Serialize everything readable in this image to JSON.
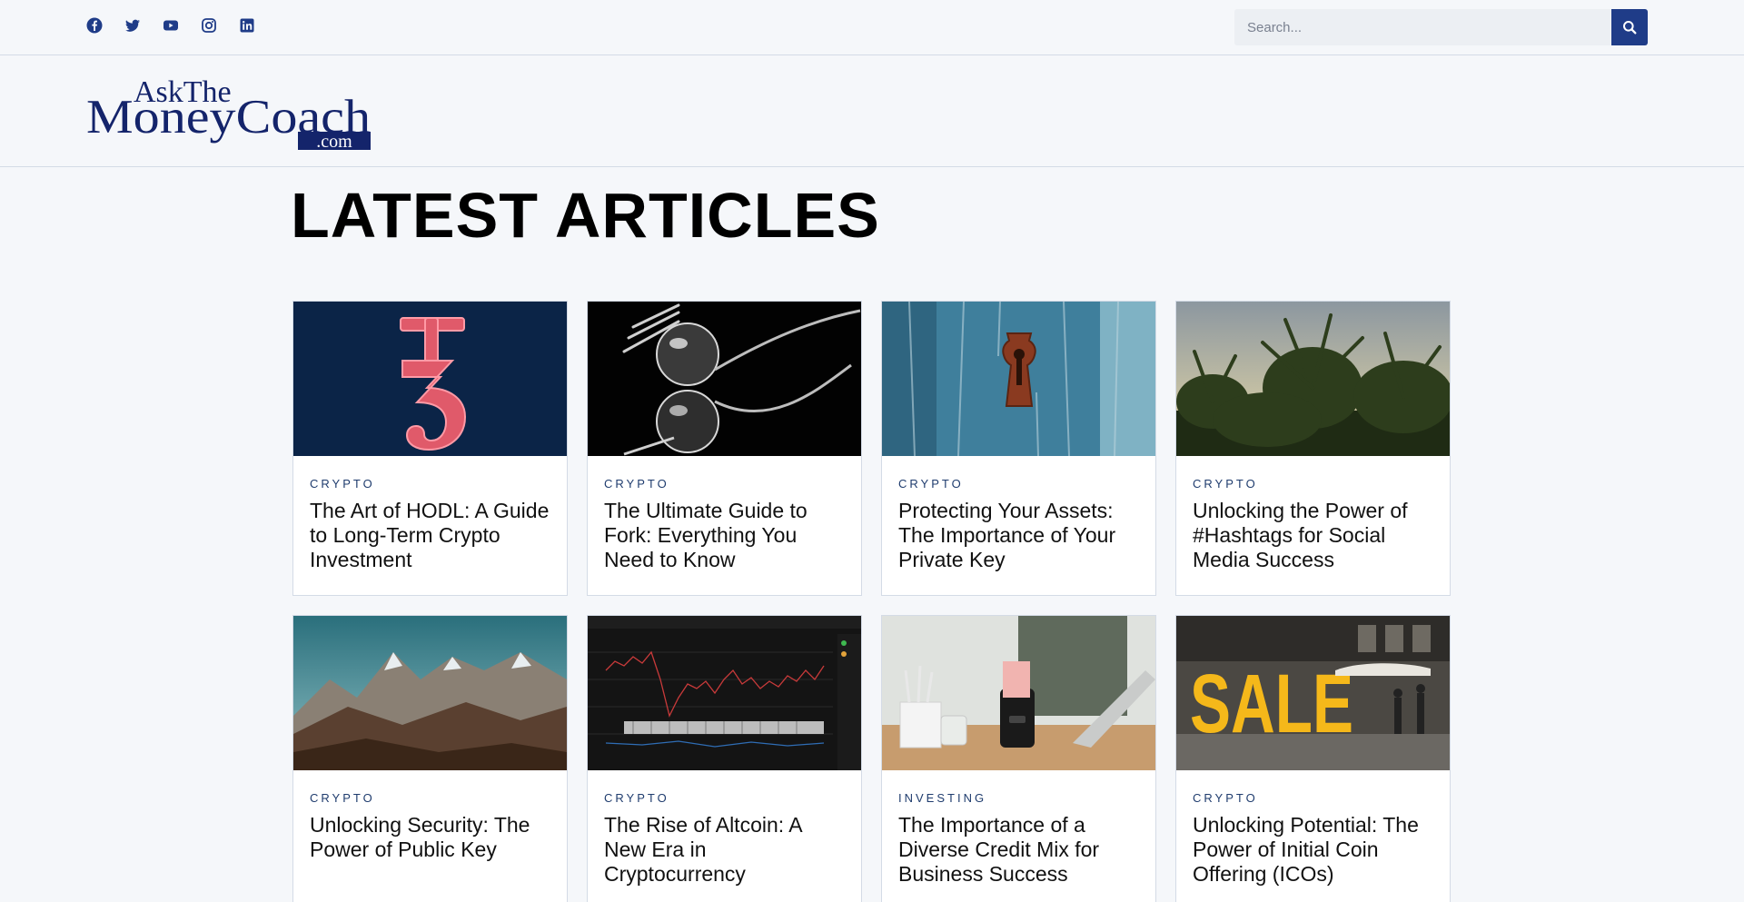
{
  "social": [
    "facebook-icon",
    "twitter-icon",
    "youtube-icon",
    "instagram-icon",
    "linkedin-icon"
  ],
  "search": {
    "placeholder": "Search...",
    "button_icon": "search-icon"
  },
  "logo": {
    "line1": "AskThe",
    "line2": "MoneyCoach",
    "line3": ".com"
  },
  "main": {
    "title": "LATEST ARTICLES"
  },
  "articles": [
    {
      "category": "CRYPTO",
      "title": "The Art of HODL: A Guide to Long-Term Crypto Investment"
    },
    {
      "category": "CRYPTO",
      "title": "The Ultimate Guide to Fork: Everything You Need to Know"
    },
    {
      "category": "CRYPTO",
      "title": "Protecting Your Assets: The Importance of Your Private Key"
    },
    {
      "category": "CRYPTO",
      "title": "Unlocking the Power of #Hashtags for Social Media Success"
    },
    {
      "category": "CRYPTO",
      "title": "Unlocking Security: The Power of Public Key"
    },
    {
      "category": "CRYPTO",
      "title": "The Rise of Altcoin: A New Era in Cryptocurrency"
    },
    {
      "category": "INVESTING",
      "title": "The Importance of a Diverse Credit Mix for Business Success"
    },
    {
      "category": "CRYPTO",
      "title": "Unlocking Potential: The Power of Initial Coin Offering (ICOs)"
    }
  ],
  "colors": {
    "brand": "#1f3c88",
    "logo_navy": "#14246b",
    "background": "#f5f7fa",
    "border": "#d4dbe6"
  }
}
